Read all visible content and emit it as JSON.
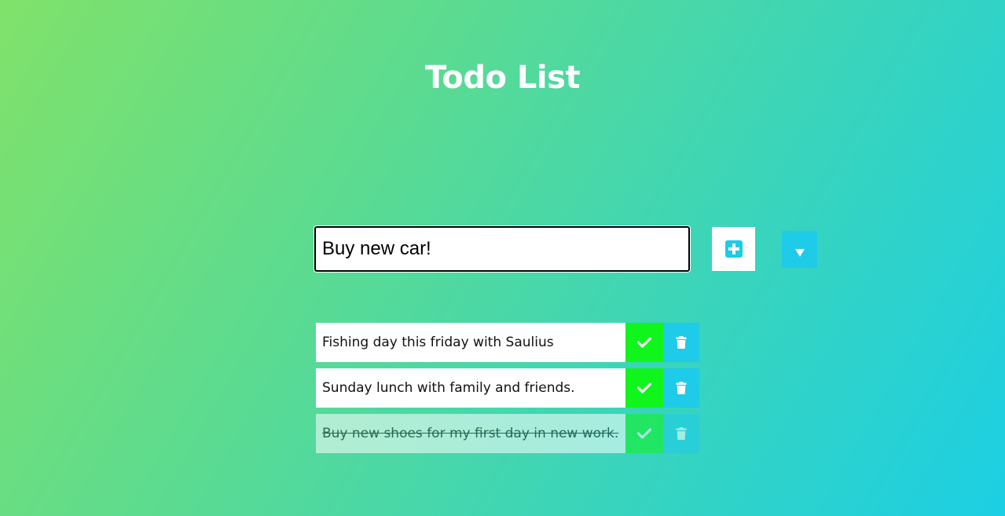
{
  "header": {
    "title": "Todo List"
  },
  "form": {
    "input_value": "Buy new car!",
    "add_icon": "plus-square-icon",
    "filter_icon": "caret-down-icon"
  },
  "todos": [
    {
      "text": "Fishing day this friday with Saulius",
      "completed": false
    },
    {
      "text": "Sunday lunch with family and friends.",
      "completed": false
    },
    {
      "text": "Buy new shoes for my first day in new work.",
      "completed": true
    }
  ],
  "colors": {
    "gradient_start": "#80e26a",
    "gradient_end": "#1ccfe4",
    "complete_button": "#10f51c",
    "trash_button": "#1ecbe8",
    "text_white": "#ffffff"
  }
}
